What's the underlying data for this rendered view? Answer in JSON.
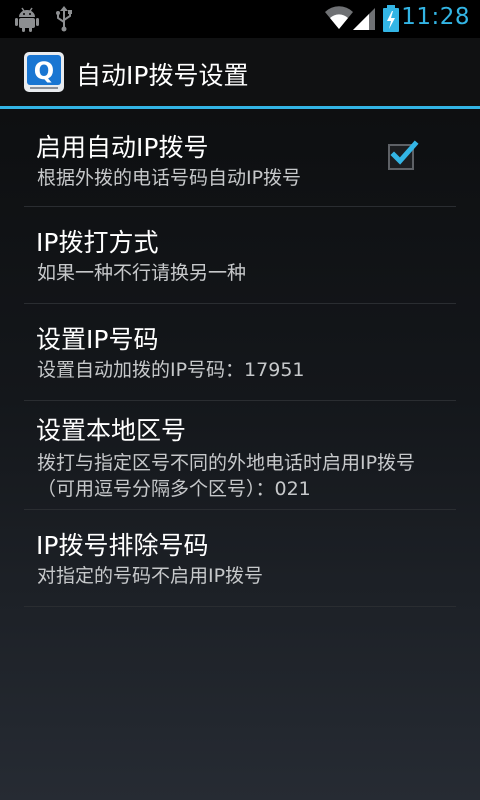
{
  "status_bar": {
    "time": "11:28",
    "accent_color": "#33b5e5",
    "icons": [
      "android-debug-icon",
      "usb-icon",
      "wifi-icon",
      "cell-signal-icon",
      "battery-charging-icon"
    ]
  },
  "app": {
    "title": "自动IP拨号设置",
    "icon": "q-app-icon",
    "icon_letter": "Q"
  },
  "preferences": [
    {
      "title": "启用自动IP拨号",
      "summary": "根据外拨的电话号码自动IP拨号",
      "checkbox": true
    },
    {
      "title": "IP拨打方式",
      "summary": "如果一种不行请换另一种"
    },
    {
      "title": "设置IP号码",
      "summary": "设置自动加拨的IP号码：17951"
    },
    {
      "title": "设置本地区号",
      "summary": "拨打与指定区号不同的外地电话时启用IP拨号（可用逗号分隔多个区号）：021"
    },
    {
      "title": "IP拨号排除号码",
      "summary": "对指定的号码不启用IP拨号"
    }
  ]
}
